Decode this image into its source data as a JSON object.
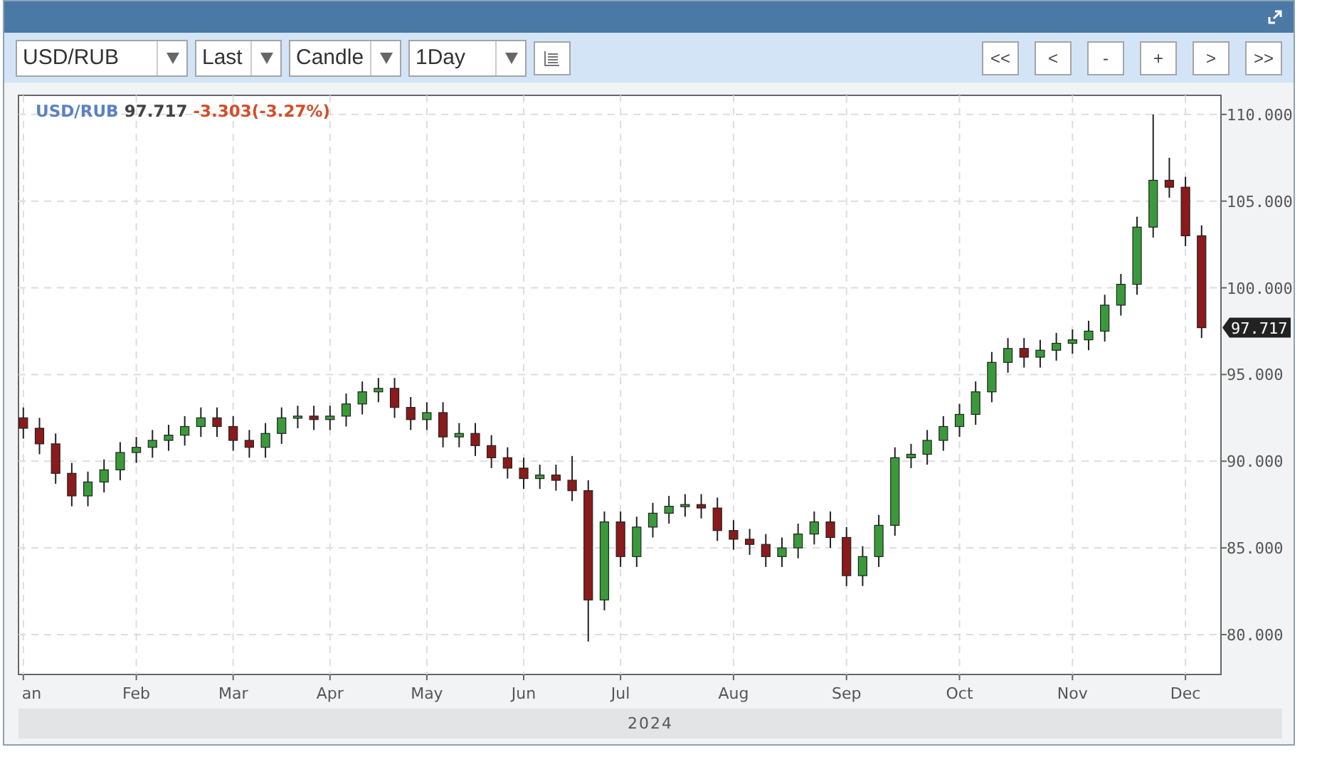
{
  "toolbar": {
    "symbol": "USD/RUB",
    "price_type": "Last",
    "chart_type": "Candle",
    "interval": "1Day",
    "nav_buttons": [
      "<<",
      "<",
      "-",
      "+",
      ">",
      ">>"
    ]
  },
  "legend": {
    "symbol": "USD/RUB",
    "last": "97.717",
    "change": "-3.303(-3.27%)"
  },
  "price_tag": "97.717",
  "year_label": "2024",
  "chart_data": {
    "type": "candlestick",
    "grid": true,
    "ylim": [
      77.7,
      111.1
    ],
    "yticks": [
      {
        "value": 80,
        "label": "80.000"
      },
      {
        "value": 85,
        "label": "85.000"
      },
      {
        "value": 90,
        "label": "90.000"
      },
      {
        "value": 95,
        "label": "95.000"
      },
      {
        "value": 100,
        "label": "100.000"
      },
      {
        "value": 105,
        "label": "105.000"
      },
      {
        "value": 110,
        "label": "110.000"
      }
    ],
    "categories": [
      "an",
      null,
      null,
      null,
      null,
      null,
      null,
      "Feb",
      null,
      null,
      null,
      null,
      null,
      "Mar",
      null,
      null,
      null,
      null,
      null,
      "Apr",
      null,
      null,
      null,
      null,
      null,
      "May",
      null,
      null,
      null,
      null,
      null,
      "Jun",
      null,
      null,
      null,
      null,
      null,
      "Jul",
      null,
      null,
      null,
      null,
      null,
      null,
      "Aug",
      null,
      null,
      null,
      null,
      null,
      null,
      "Sep",
      null,
      null,
      null,
      null,
      null,
      null,
      "Oct",
      null,
      null,
      null,
      null,
      null,
      null,
      "Nov",
      null,
      null,
      null,
      null,
      null,
      null,
      "Dec",
      null
    ],
    "ohlc": [
      [
        92.5,
        93.1,
        91.3,
        91.9
      ],
      [
        91.9,
        92.5,
        90.4,
        91.0
      ],
      [
        91.0,
        91.6,
        88.7,
        89.3
      ],
      [
        89.3,
        89.9,
        87.4,
        88.0
      ],
      [
        88.0,
        89.4,
        87.4,
        88.8
      ],
      [
        88.8,
        90.1,
        88.2,
        89.5
      ],
      [
        89.5,
        91.1,
        88.9,
        90.5
      ],
      [
        90.5,
        91.4,
        89.9,
        90.8
      ],
      [
        90.8,
        91.8,
        90.2,
        91.2
      ],
      [
        91.2,
        92.1,
        90.6,
        91.5
      ],
      [
        91.5,
        92.6,
        90.9,
        92.0
      ],
      [
        92.0,
        93.1,
        91.4,
        92.5
      ],
      [
        92.5,
        93.1,
        91.4,
        92.0
      ],
      [
        92.0,
        92.6,
        90.6,
        91.2
      ],
      [
        91.2,
        91.8,
        90.2,
        90.8
      ],
      [
        90.8,
        92.2,
        90.2,
        91.6
      ],
      [
        91.6,
        93.1,
        91.0,
        92.5
      ],
      [
        92.5,
        93.2,
        91.9,
        92.6
      ],
      [
        92.6,
        93.2,
        91.8,
        92.4
      ],
      [
        92.4,
        93.2,
        91.8,
        92.6
      ],
      [
        92.6,
        93.9,
        92.0,
        93.3
      ],
      [
        93.3,
        94.6,
        92.7,
        94.0
      ],
      [
        94.0,
        94.8,
        93.4,
        94.2
      ],
      [
        94.2,
        94.8,
        92.5,
        93.1
      ],
      [
        93.1,
        93.7,
        91.8,
        92.4
      ],
      [
        92.4,
        93.4,
        91.8,
        92.8
      ],
      [
        92.8,
        93.4,
        90.8,
        91.4
      ],
      [
        91.4,
        92.2,
        90.8,
        91.6
      ],
      [
        91.6,
        92.2,
        90.3,
        90.9
      ],
      [
        90.9,
        91.5,
        89.6,
        90.2
      ],
      [
        90.2,
        90.8,
        89.0,
        89.6
      ],
      [
        89.6,
        90.2,
        88.4,
        89.0
      ],
      [
        89.0,
        89.8,
        88.4,
        89.2
      ],
      [
        89.2,
        89.8,
        88.3,
        88.9
      ],
      [
        88.9,
        90.3,
        87.7,
        88.3
      ],
      [
        88.3,
        88.9,
        79.6,
        82.0
      ],
      [
        82.0,
        87.1,
        81.4,
        86.5
      ],
      [
        86.5,
        87.1,
        83.9,
        84.5
      ],
      [
        84.5,
        86.8,
        83.9,
        86.2
      ],
      [
        86.2,
        87.6,
        85.6,
        87.0
      ],
      [
        87.0,
        88.0,
        86.4,
        87.4
      ],
      [
        87.4,
        88.1,
        86.8,
        87.5
      ],
      [
        87.5,
        88.1,
        86.7,
        87.3
      ],
      [
        87.3,
        87.9,
        85.4,
        86.0
      ],
      [
        86.0,
        86.6,
        84.9,
        85.5
      ],
      [
        85.5,
        86.1,
        84.6,
        85.2
      ],
      [
        85.2,
        85.8,
        83.9,
        84.5
      ],
      [
        84.5,
        85.6,
        83.9,
        85.0
      ],
      [
        85.0,
        86.4,
        84.4,
        85.8
      ],
      [
        85.8,
        87.1,
        85.2,
        86.5
      ],
      [
        86.5,
        87.1,
        85.0,
        85.6
      ],
      [
        85.6,
        86.2,
        82.8,
        83.4
      ],
      [
        83.4,
        85.1,
        82.8,
        84.5
      ],
      [
        84.5,
        86.9,
        83.9,
        86.3
      ],
      [
        86.3,
        90.8,
        85.7,
        90.2
      ],
      [
        90.2,
        91.0,
        89.6,
        90.4
      ],
      [
        90.4,
        91.8,
        89.8,
        91.2
      ],
      [
        91.2,
        92.6,
        90.6,
        92.0
      ],
      [
        92.0,
        93.3,
        91.4,
        92.7
      ],
      [
        92.7,
        94.6,
        92.1,
        94.0
      ],
      [
        94.0,
        96.3,
        93.4,
        95.7
      ],
      [
        95.7,
        97.1,
        95.1,
        96.5
      ],
      [
        96.5,
        97.1,
        95.4,
        96.0
      ],
      [
        96.0,
        97.0,
        95.4,
        96.4
      ],
      [
        96.4,
        97.4,
        95.8,
        96.8
      ],
      [
        96.8,
        97.6,
        96.2,
        97.0
      ],
      [
        97.0,
        98.1,
        96.4,
        97.5
      ],
      [
        97.5,
        99.6,
        96.9,
        99.0
      ],
      [
        99.0,
        100.8,
        98.4,
        100.2
      ],
      [
        100.2,
        104.1,
        99.6,
        103.5
      ],
      [
        103.5,
        110.0,
        102.9,
        106.2
      ],
      [
        106.2,
        107.5,
        105.2,
        105.8
      ],
      [
        105.8,
        106.4,
        102.4,
        103.0
      ],
      [
        103.0,
        103.6,
        97.1,
        97.7
      ]
    ]
  }
}
